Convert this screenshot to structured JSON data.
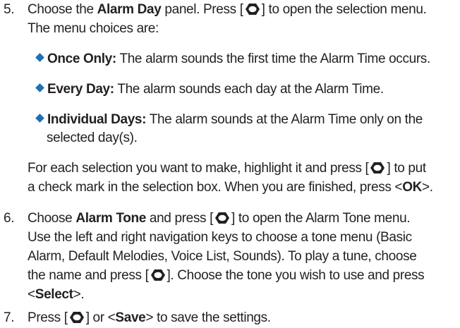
{
  "step5": {
    "num": "5.",
    "l1_a": "Choose the ",
    "l1_bold": "Alarm Day",
    "l1_b": " panel. Press [",
    "l1_c": "] to open the selection menu.",
    "l2": "The menu choices are:",
    "opt1_bold": "Once Only:",
    "opt1_text": " The alarm sounds the first time the Alarm Time occurs.",
    "opt2_bold": "Every Day:",
    "opt2_text": " The alarm sounds each day at the Alarm Time.",
    "opt3_bold": "Individual Days:",
    "opt3_text": " The alarm sounds at the Alarm Time only on the",
    "opt3_cont": "selected day(s).",
    "p_l1_a": "For each selection you want to make, highlight it and press [",
    "p_l1_b": "] to put",
    "p_l2_a": "a check mark in the selection box. When you are finished, press <",
    "p_l2_bold": "OK",
    "p_l2_b": ">."
  },
  "step6": {
    "num": "6.",
    "l1_a": "Choose ",
    "l1_bold": "Alarm Tone",
    "l1_b": " and press [",
    "l1_c": "] to open the Alarm Tone menu.",
    "l2": "Use the left and right navigation keys to choose a tone menu (Basic",
    "l3": "Alarm, Default Melodies, Voice List, Sounds). To play a tune, choose",
    "l4_a": "the name and press [",
    "l4_b": "]. Choose the tone you wish to use and press",
    "l5_a": "<",
    "l5_bold": "Select",
    "l5_b": ">."
  },
  "step7": {
    "num": "7.",
    "l1_a": "Press [",
    "l1_b": "] or <",
    "l1_bold": "Save",
    "l1_c": "> to save the settings."
  },
  "colors": {
    "text": "#231f20",
    "bullet": "#1f6fb5",
    "key_icon": "#231f20"
  },
  "icons": {
    "select_key": "navigation-select-key-icon",
    "bullet": "diamond-bullet-icon"
  }
}
